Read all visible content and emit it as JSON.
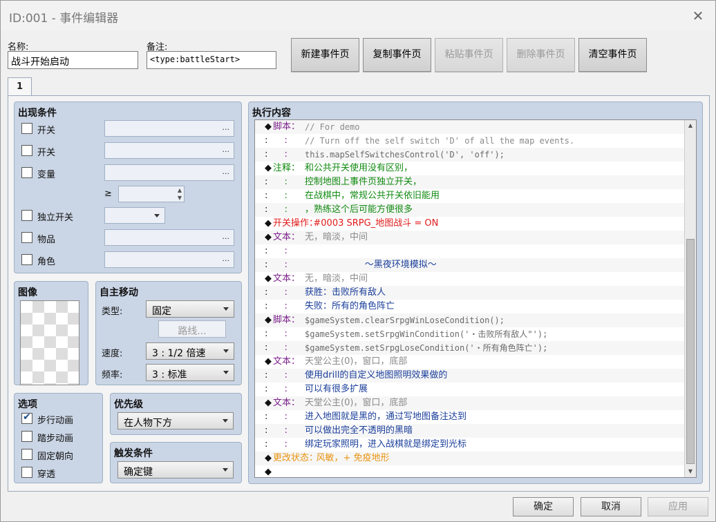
{
  "window": {
    "title": "ID:001 - 事件编辑器",
    "close_glyph": "✕"
  },
  "fields": {
    "name_label": "名称:",
    "name_value": "战斗开始启动",
    "note_label": "备注:",
    "note_value": "<type:battleStart>"
  },
  "toolbar": {
    "new_page": "新建事件页",
    "copy_page": "复制事件页",
    "paste_page": "粘贴事件页",
    "delete_page": "删除事件页",
    "clear_page": "清空事件页"
  },
  "tabs": [
    {
      "label": "1",
      "selected": true
    }
  ],
  "conditions": {
    "title": "出现条件",
    "switch1": "开关",
    "switch2": "开关",
    "variable": "变量",
    "gte": "≥",
    "self_switch": "独立开关",
    "item": "物品",
    "actor": "角色",
    "dots": "..."
  },
  "image": {
    "title": "图像"
  },
  "movement": {
    "title": "自主移动",
    "type_label": "类型:",
    "type_value": "固定",
    "route_button": "路线...",
    "speed_label": "速度:",
    "speed_value": "3 : 1/2 倍速",
    "freq_label": "频率:",
    "freq_value": "3 : 标准"
  },
  "options": {
    "title": "选项",
    "items": [
      {
        "label": "步行动画",
        "checked": true
      },
      {
        "label": "踏步动画",
        "checked": false
      },
      {
        "label": "固定朝向",
        "checked": false
      },
      {
        "label": "穿透",
        "checked": false
      }
    ],
    "check_glyph": "✔"
  },
  "priority": {
    "title": "优先级",
    "value": "在人物下方"
  },
  "trigger": {
    "title": "触发条件",
    "value": "确定键"
  },
  "contents": {
    "title": "执行内容",
    "lines": [
      {
        "ind": "◆",
        "cmd": "脚本：",
        "cmd_color": "#7a1f8a",
        "par": "// For demo",
        "par_color": "#8a8a8a",
        "mono": true
      },
      {
        "ind": ":",
        "cmd": "    :",
        "cmd_color": "#7a1f8a",
        "par": "// Turn off the self switch 'D' of all the map events.",
        "par_color": "#8a8a8a",
        "mono": true
      },
      {
        "ind": ":",
        "cmd": "    :",
        "cmd_color": "#7a1f8a",
        "par": "this.mapSelfSwitchesControl('D', 'off');",
        "par_color": "#6a6a6a",
        "mono": true
      },
      {
        "ind": "◆",
        "cmd": "注释：",
        "cmd_color": "#118a11",
        "par": "和公共开关使用没有区别，",
        "par_color": "#118a11",
        "mono": false
      },
      {
        "ind": ":",
        "cmd": "    :",
        "cmd_color": "#118a11",
        "par": "控制地图上事件页独立开关，",
        "par_color": "#118a11",
        "mono": false
      },
      {
        "ind": ":",
        "cmd": "    :",
        "cmd_color": "#118a11",
        "par": "在战棋中，常规公共开关依旧能用",
        "par_color": "#118a11",
        "mono": false
      },
      {
        "ind": ":",
        "cmd": "    :",
        "cmd_color": "#118a11",
        "par": "，熟练这个后可能方便很多",
        "par_color": "#118a11",
        "mono": false
      },
      {
        "ind": "◆",
        "cmd": "开关操作：",
        "cmd_color": "#e01a1a",
        "par": "   #0003 SRPG_地图战斗 = ON",
        "par_color": "#e01a1a",
        "mono": false
      },
      {
        "ind": "◆",
        "cmd": "文本：",
        "cmd_color": "#7a1f8a",
        "par": "无，暗淡，中间",
        "par_color": "#8a8a8a",
        "mono": false
      },
      {
        "ind": ":",
        "cmd": "    :",
        "cmd_color": "#7a1f8a",
        "par": "",
        "par_color": "#1a3e9a",
        "mono": false
      },
      {
        "ind": ":",
        "cmd": "    :",
        "cmd_color": "#7a1f8a",
        "par": "                     ～黑夜环境模拟～",
        "par_color": "#1a3e9a",
        "mono": false
      },
      {
        "ind": "◆",
        "cmd": "文本：",
        "cmd_color": "#7a1f8a",
        "par": "无，暗淡，中间",
        "par_color": "#8a8a8a",
        "mono": false
      },
      {
        "ind": ":",
        "cmd": "    :",
        "cmd_color": "#7a1f8a",
        "par": "获胜：击败所有敌人",
        "par_color": "#1a3e9a",
        "mono": false
      },
      {
        "ind": ":",
        "cmd": "    :",
        "cmd_color": "#7a1f8a",
        "par": "失败：所有的角色阵亡",
        "par_color": "#1a3e9a",
        "mono": false
      },
      {
        "ind": "◆",
        "cmd": "脚本：",
        "cmd_color": "#7a1f8a",
        "par": "$gameSystem.clearSrpgWinLoseCondition();",
        "par_color": "#6a6a6a",
        "mono": true
      },
      {
        "ind": ":",
        "cmd": "    :",
        "cmd_color": "#7a1f8a",
        "par": "$gameSystem.setSrpgWinCondition('・击败所有敌人\"');",
        "par_color": "#6a6a6a",
        "mono": true
      },
      {
        "ind": ":",
        "cmd": "    :",
        "cmd_color": "#7a1f8a",
        "par": "$gameSystem.setSrpgLoseCondition('・所有角色阵亡');",
        "par_color": "#6a6a6a",
        "mono": true
      },
      {
        "ind": "◆",
        "cmd": "文本：",
        "cmd_color": "#7a1f8a",
        "par": "天堂公主(0)，窗口，底部",
        "par_color": "#8a8a8a",
        "mono": false
      },
      {
        "ind": ":",
        "cmd": "    :",
        "cmd_color": "#7a1f8a",
        "par": "使用drill的自定义地图照明效果做的",
        "par_color": "#1a3e9a",
        "mono": false
      },
      {
        "ind": ":",
        "cmd": "    :",
        "cmd_color": "#7a1f8a",
        "par": "可以有很多扩展",
        "par_color": "#1a3e9a",
        "mono": false
      },
      {
        "ind": "◆",
        "cmd": "文本：",
        "cmd_color": "#7a1f8a",
        "par": "天堂公主(0)，窗口，底部",
        "par_color": "#8a8a8a",
        "mono": false
      },
      {
        "ind": ":",
        "cmd": "    :",
        "cmd_color": "#7a1f8a",
        "par": "进入地图就是黑的，通过写地图备注达到",
        "par_color": "#1a3e9a",
        "mono": false
      },
      {
        "ind": ":",
        "cmd": "    :",
        "cmd_color": "#7a1f8a",
        "par": "可以做出完全不透明的黑暗",
        "par_color": "#1a3e9a",
        "mono": false
      },
      {
        "ind": ":",
        "cmd": "    :",
        "cmd_color": "#7a1f8a",
        "par": "绑定玩家照明，进入战棋就是绑定到光标",
        "par_color": "#1a3e9a",
        "mono": false
      },
      {
        "ind": "◆",
        "cmd": "更改状态：",
        "cmd_color": "#e8930f",
        "par": "    风敏，+ 免疫地形",
        "par_color": "#e8930f",
        "mono": false
      },
      {
        "ind": "◆",
        "cmd": "",
        "cmd_color": "#111",
        "par": "",
        "par_color": "#111",
        "mono": false
      }
    ]
  },
  "scroll": {
    "up": "▲",
    "down": "▼"
  },
  "buttons": {
    "ok": "确定",
    "cancel": "取消",
    "apply": "应用"
  }
}
